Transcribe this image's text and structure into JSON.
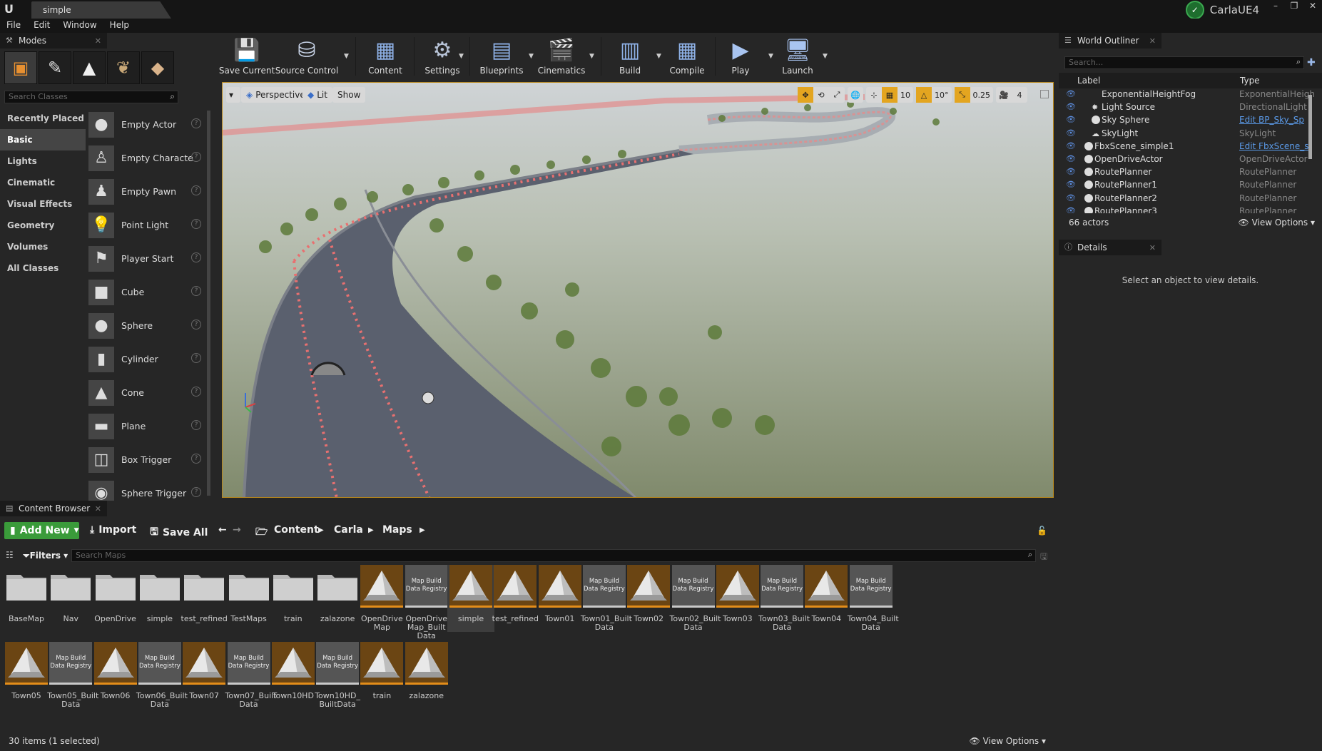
{
  "window": {
    "doc_tab": "simple",
    "project": "CarlaUE4",
    "controls": [
      "–",
      "❐",
      "✕"
    ]
  },
  "menu": [
    "File",
    "Edit",
    "Window",
    "Help"
  ],
  "modes": {
    "title": "Modes",
    "search_placeholder": "Search Classes",
    "categories": [
      "Recently Placed",
      "Basic",
      "Lights",
      "Cinematic",
      "Visual Effects",
      "Geometry",
      "Volumes",
      "All Classes"
    ],
    "selected_category": "Basic",
    "classes": [
      "Empty Actor",
      "Empty Characte",
      "Empty Pawn",
      "Point Light",
      "Player Start",
      "Cube",
      "Sphere",
      "Cylinder",
      "Cone",
      "Plane",
      "Box Trigger",
      "Sphere Trigger"
    ]
  },
  "toolbar": {
    "save_current": "Save Current",
    "source_control": "Source Control",
    "content": "Content",
    "settings": "Settings",
    "blueprints": "Blueprints",
    "cinematics": "Cinematics",
    "build": "Build",
    "compile": "Compile",
    "play": "Play",
    "launch": "Launch"
  },
  "viewport": {
    "perspective": "Perspective",
    "lit": "Lit",
    "show": "Show",
    "grid_snap": "10",
    "rotation_snap": "10°",
    "scale_snap": "0.25",
    "camera_speed": "4"
  },
  "outliner": {
    "title": "World Outliner",
    "search_placeholder": "Search...",
    "col_label": "Label",
    "col_type": "Type",
    "rows": [
      {
        "label": "ExponentialHeightFog",
        "type": "ExponentialHeigh"
      },
      {
        "label": "Light Source",
        "type": "DirectionalLight"
      },
      {
        "label": "Sky Sphere",
        "type": "Edit BP_Sky_Sp"
      },
      {
        "label": "SkyLight",
        "type": "SkyLight"
      },
      {
        "label": "FbxScene_simple1",
        "type": "Edit FbxScene_s"
      },
      {
        "label": "OpenDriveActor",
        "type": "OpenDriveActor"
      },
      {
        "label": "RoutePlanner",
        "type": "RoutePlanner"
      },
      {
        "label": "RoutePlanner1",
        "type": "RoutePlanner"
      },
      {
        "label": "RoutePlanner2",
        "type": "RoutePlanner"
      },
      {
        "label": "RoutePlanner3",
        "type": "RoutePlanner"
      }
    ],
    "actor_count": "66 actors",
    "view_options": "View Options"
  },
  "details": {
    "title": "Details",
    "message": "Select an object to view details."
  },
  "content_browser": {
    "title": "Content Browser",
    "add_new": "Add New",
    "import": "Import",
    "save_all": "Save All",
    "breadcrumb": [
      "Content",
      "Carla",
      "Maps"
    ],
    "filters": "Filters",
    "search_placeholder": "Search Maps",
    "registry_label": "Map Build Data Registry",
    "assets": [
      {
        "name": "BaseMap",
        "kind": "folder"
      },
      {
        "name": "Nav",
        "kind": "folder"
      },
      {
        "name": "OpenDrive",
        "kind": "folder"
      },
      {
        "name": "simple",
        "kind": "folder"
      },
      {
        "name": "test_refined",
        "kind": "folder"
      },
      {
        "name": "TestMaps",
        "kind": "folder"
      },
      {
        "name": "train",
        "kind": "folder"
      },
      {
        "name": "zalazone",
        "kind": "folder"
      },
      {
        "name": "OpenDrive Map",
        "kind": "map"
      },
      {
        "name": "OpenDrive Map_Built Data",
        "kind": "reg"
      },
      {
        "name": "simple",
        "kind": "map",
        "selected": true
      },
      {
        "name": "test_refined",
        "kind": "map"
      },
      {
        "name": "Town01",
        "kind": "map"
      },
      {
        "name": "Town01_Built Data",
        "kind": "reg"
      },
      {
        "name": "Town02",
        "kind": "map"
      },
      {
        "name": "Town02_Built Data",
        "kind": "reg"
      },
      {
        "name": "Town03",
        "kind": "map"
      },
      {
        "name": "Town03_Built Data",
        "kind": "reg"
      },
      {
        "name": "Town04",
        "kind": "map"
      },
      {
        "name": "Town04_Built Data",
        "kind": "reg"
      },
      {
        "name": "Town05",
        "kind": "map"
      },
      {
        "name": "Town05_Built Data",
        "kind": "reg"
      },
      {
        "name": "Town06",
        "kind": "map"
      },
      {
        "name": "Town06_Built Data",
        "kind": "reg"
      },
      {
        "name": "Town07",
        "kind": "map"
      },
      {
        "name": "Town07_Built Data",
        "kind": "reg"
      },
      {
        "name": "Town10HD",
        "kind": "map"
      },
      {
        "name": "Town10HD_ BuiltData",
        "kind": "reg"
      },
      {
        "name": "train",
        "kind": "map"
      },
      {
        "name": "zalazone",
        "kind": "map"
      }
    ],
    "item_count": "30 items (1 selected)",
    "view_options": "View Options"
  }
}
